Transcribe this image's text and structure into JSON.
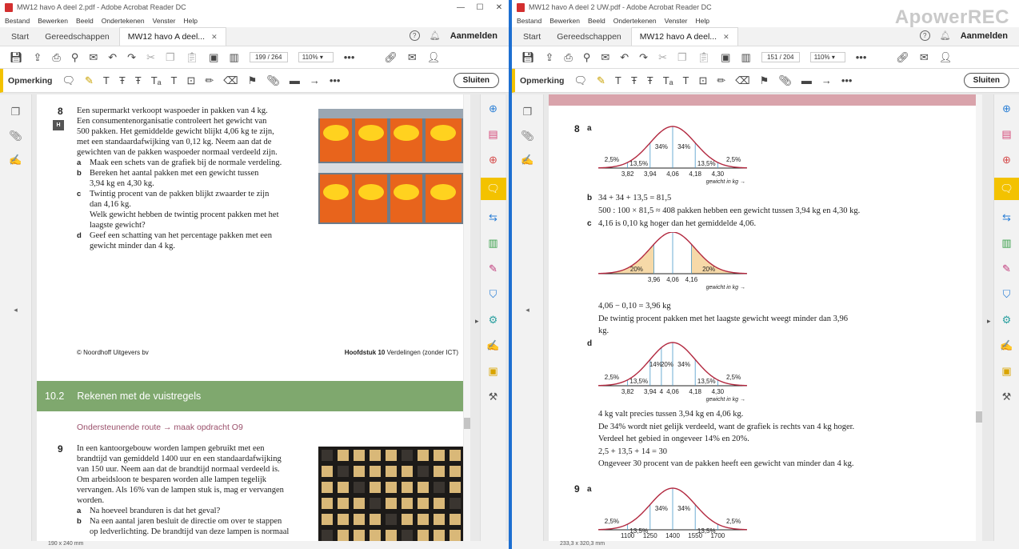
{
  "left_window": {
    "title": "MW12 havo A deel 2.pdf - Adobe Acrobat Reader DC",
    "menu": [
      "Bestand",
      "Bewerken",
      "Beeld",
      "Ondertekenen",
      "Venster",
      "Help"
    ],
    "tabs": {
      "start": "Start",
      "tools": "Gereedschappen",
      "doc": "MW12 havo A deel..."
    },
    "signin": "Aanmelden",
    "page_current": "199",
    "page_total": "/ 264",
    "zoom": "110%",
    "comment_label": "Opmerking",
    "close_label": "Sluiten",
    "status": "190 x 240 mm"
  },
  "right_window": {
    "title": "MW12 havo A deel 2 UW.pdf - Adobe Acrobat Reader DC",
    "menu": [
      "Bestand",
      "Bewerken",
      "Beeld",
      "Ondertekenen",
      "Venster",
      "Help"
    ],
    "tabs": {
      "start": "Start",
      "tools": "Gereedschappen",
      "doc": "MW12 havo A deel..."
    },
    "signin": "Aanmelden",
    "page_current": "151",
    "page_total": "/ 204",
    "zoom": "110%",
    "comment_label": "Opmerking",
    "close_label": "Sluiten",
    "status": "233,3 x 320,3 mm"
  },
  "watermark": "ApowerREC",
  "exercise8": {
    "number": "8",
    "badge": "H",
    "intro": [
      "Een supermarkt verkoopt waspoeder in pakken van 4 kg.",
      "Een consumentenorganisatie controleert het gewicht van",
      "500 pakken. Het gemiddelde gewicht blijkt 4,06 kg te zijn,",
      "met een standaardafwijking van 0,12 kg. Neem aan dat de",
      "gewichten van de pakken waspoeder normaal verdeeld zijn."
    ],
    "a": "Maak een schets van de grafiek bij de normale verdeling.",
    "b": [
      "Bereken het aantal pakken met een gewicht tussen",
      "3,94 kg en 4,30 kg."
    ],
    "c": [
      "Twintig procent van de pakken blijkt zwaarder te zijn",
      "dan 4,16 kg.",
      "Welk gewicht hebben de twintig procent pakken met het",
      "laagste gewicht?"
    ],
    "d": [
      "Geef een schatting van het percentage pakken met een",
      "gewicht minder dan 4 kg."
    ],
    "photo_text": "Tide"
  },
  "footer": {
    "left": "© Noordhoff Uitgevers bv",
    "chapter": "Hoofdstuk 10",
    "chapter_title": "Verdelingen (zonder ICT)"
  },
  "section": {
    "number": "10.2",
    "title": "Rekenen met de vuistregels",
    "route": "Ondersteunende route → maak opdracht O9"
  },
  "exercise9": {
    "number": "9",
    "intro": [
      "In een kantoorgebouw worden lampen gebruikt met een",
      "brandtijd van gemiddeld 1400 uur en een standaardafwijking",
      "van 150 uur. Neem aan dat de brandtijd normaal verdeeld is.",
      "Om arbeidsloon te besparen worden alle lampen tegelijk",
      "vervangen. Als 16% van de lampen stuk is, mag er vervangen",
      "worden."
    ],
    "a": "Na hoeveel branduren is dat het geval?",
    "b": [
      "Na een aantal jaren besluit de directie om over te stappen",
      "op ledverlichting. De brandtijd van deze lampen is normaal"
    ]
  },
  "answers": {
    "q8": "8",
    "a": "a",
    "b_label": "b",
    "b": [
      "34 + 34 + 13,5 = 81,5",
      "500 : 100 × 81,5 ≈ 408 pakken hebben een gewicht tussen 3,94 kg en 4,30 kg."
    ],
    "c_label": "c",
    "c1": "4,16 is 0,10 kg hoger dan het gemiddelde 4,06.",
    "c2": [
      "4,06 − 0,10 = 3,96 kg",
      "De twintig procent pakken met het laagste gewicht weegt minder dan 3,96",
      "kg."
    ],
    "d_label": "d",
    "d": [
      "4 kg valt precies tussen 3,94 kg en 4,06 kg.",
      "De 34% wordt niet gelijk verdeeld, want de grafiek is rechts van 4 kg hoger.",
      "Verdeel het gebied in ongeveer 14% en 20%.",
      "2,5 + 13,5 + 14 = 30",
      "Ongeveer 30 procent van de pakken heeft een gewicht van minder dan 4 kg."
    ],
    "q9": "9",
    "a9": "a"
  },
  "graphs": {
    "g1": {
      "pcts": [
        "2,5%",
        "13,5%",
        "34%",
        "34%",
        "13,5%",
        "2,5%"
      ],
      "ticks": [
        "3,82",
        "3,94",
        "4,06",
        "4,18",
        "4,30"
      ],
      "axis": "gewicht in kg →"
    },
    "g2": {
      "pcts": [
        "20%",
        "20%"
      ],
      "ticks": [
        "3,96",
        "4,06",
        "4,16"
      ],
      "axis": "gewicht in kg →"
    },
    "g3": {
      "pcts": [
        "2,5%",
        "13,5%",
        "14%",
        "20%",
        "34%",
        "13,5%",
        "2,5%"
      ],
      "ticks": [
        "3,82",
        "3,94",
        "4",
        "4,06",
        "4,18",
        "4,30"
      ],
      "axis": "gewicht in kg →"
    },
    "g4": {
      "pcts": [
        "2,5%",
        "13,5%",
        "34%",
        "34%",
        "13,5%",
        "2,5%"
      ],
      "ticks": [
        "1100",
        "1250",
        "1400",
        "1550",
        "1700"
      ]
    }
  },
  "colors": {
    "accent_yellow": "#f3c200",
    "section_green": "#7fa86e",
    "curve_red": "#b2283f",
    "divider_blue": "#1d6fd1"
  }
}
